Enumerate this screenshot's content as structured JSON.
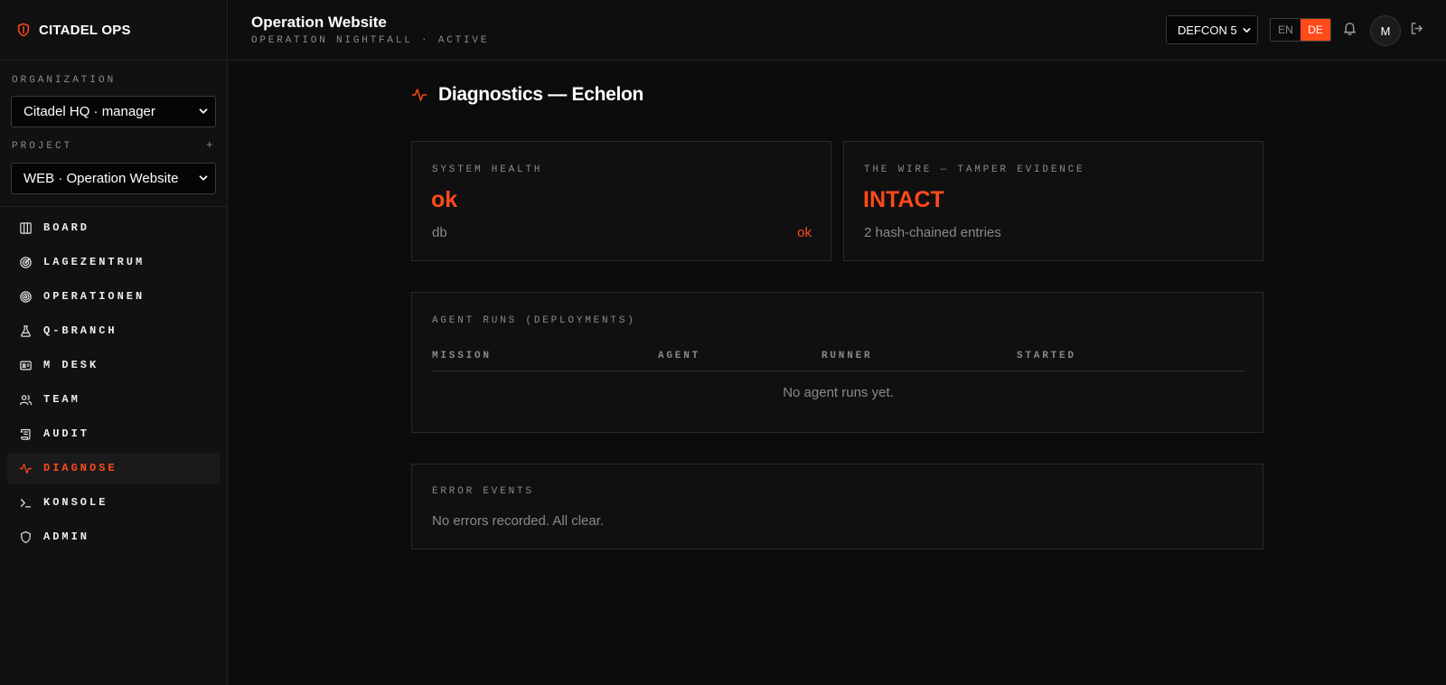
{
  "app": {
    "name": "CITADEL OPS",
    "accent": "#ff4a1a"
  },
  "sidebar": {
    "organization_label": "ORGANIZATION",
    "organization_value": "Citadel HQ · manager",
    "project_label": "PROJECT",
    "project_add": "+",
    "project_value": "WEB · Operation Website",
    "items": [
      {
        "label": "BOARD",
        "icon": "board-columns-icon"
      },
      {
        "label": "LAGEZENTRUM",
        "icon": "radar-icon"
      },
      {
        "label": "OPERATIONEN",
        "icon": "target-icon"
      },
      {
        "label": "Q-BRANCH",
        "icon": "flask-icon"
      },
      {
        "label": "M DESK",
        "icon": "id-card-icon"
      },
      {
        "label": "TEAM",
        "icon": "users-icon"
      },
      {
        "label": "AUDIT",
        "icon": "scroll-icon"
      },
      {
        "label": "DIAGNOSE",
        "icon": "activity-icon",
        "active": true
      },
      {
        "label": "KONSOLE",
        "icon": "terminal-icon"
      },
      {
        "label": "ADMIN",
        "icon": "shield-icon"
      }
    ]
  },
  "header": {
    "title": "Operation Website",
    "subtitle": "OPERATION NIGHTFALL · ACTIVE",
    "defcon": "DEFCON 5",
    "lang_en": "EN",
    "lang_de": "DE",
    "avatar": "M"
  },
  "main": {
    "title": "Diagnostics — Echelon",
    "health": {
      "label": "SYSTEM HEALTH",
      "status": "ok",
      "db_label": "db",
      "db_value": "ok"
    },
    "wire": {
      "label": "THE WIRE — TAMPER EVIDENCE",
      "status": "INTACT",
      "entries": "2 hash-chained entries"
    },
    "runs": {
      "label": "AGENT RUNS (DEPLOYMENTS)",
      "columns": [
        "MISSION",
        "AGENT",
        "RUNNER",
        "STARTED"
      ],
      "empty": "No agent runs yet."
    },
    "errors": {
      "label": "ERROR EVENTS",
      "empty": "No errors recorded. All clear."
    }
  }
}
